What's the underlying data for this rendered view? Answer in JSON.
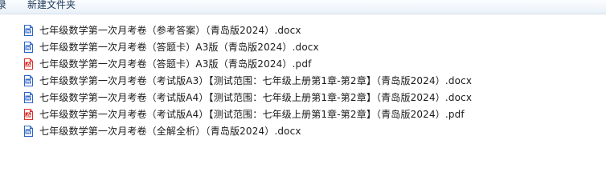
{
  "toolbar": {
    "prev_label": "录",
    "new_folder_label": "新建文件夹"
  },
  "files": [
    {
      "name": "七年级数学第一次月考卷（参考答案）（青岛版2024）.docx",
      "icon": "word-doc-icon"
    },
    {
      "name": "七年级数学第一次月考卷（答题卡）A3版（青岛版2024）.docx",
      "icon": "word-doc-icon"
    },
    {
      "name": "七年级数学第一次月考卷（答题卡）A3版（青岛版2024）.pdf",
      "icon": "pdf-doc-icon"
    },
    {
      "name": "七年级数学第一次月考卷（考试版A3）【测试范围：七年级上册第1章-第2章】（青岛版2024）.docx",
      "icon": "word-doc-icon"
    },
    {
      "name": "七年级数学第一次月考卷（考试版A4）【测试范围：七年级上册第1章-第2章】（青岛版2024）.docx",
      "icon": "word-doc-icon"
    },
    {
      "name": "七年级数学第一次月考卷（考试版A4）【测试范围：七年级上册第1章-第2章】（青岛版2024）.pdf",
      "icon": "pdf-doc-icon"
    },
    {
      "name": "七年级数学第一次月考卷（全解全析）（青岛版2024）.docx",
      "icon": "word-doc-icon"
    }
  ],
  "colors": {
    "word_icon": "#2b65c4",
    "pdf_icon": "#d9302a",
    "toolbar_text": "#1e3a5a"
  }
}
